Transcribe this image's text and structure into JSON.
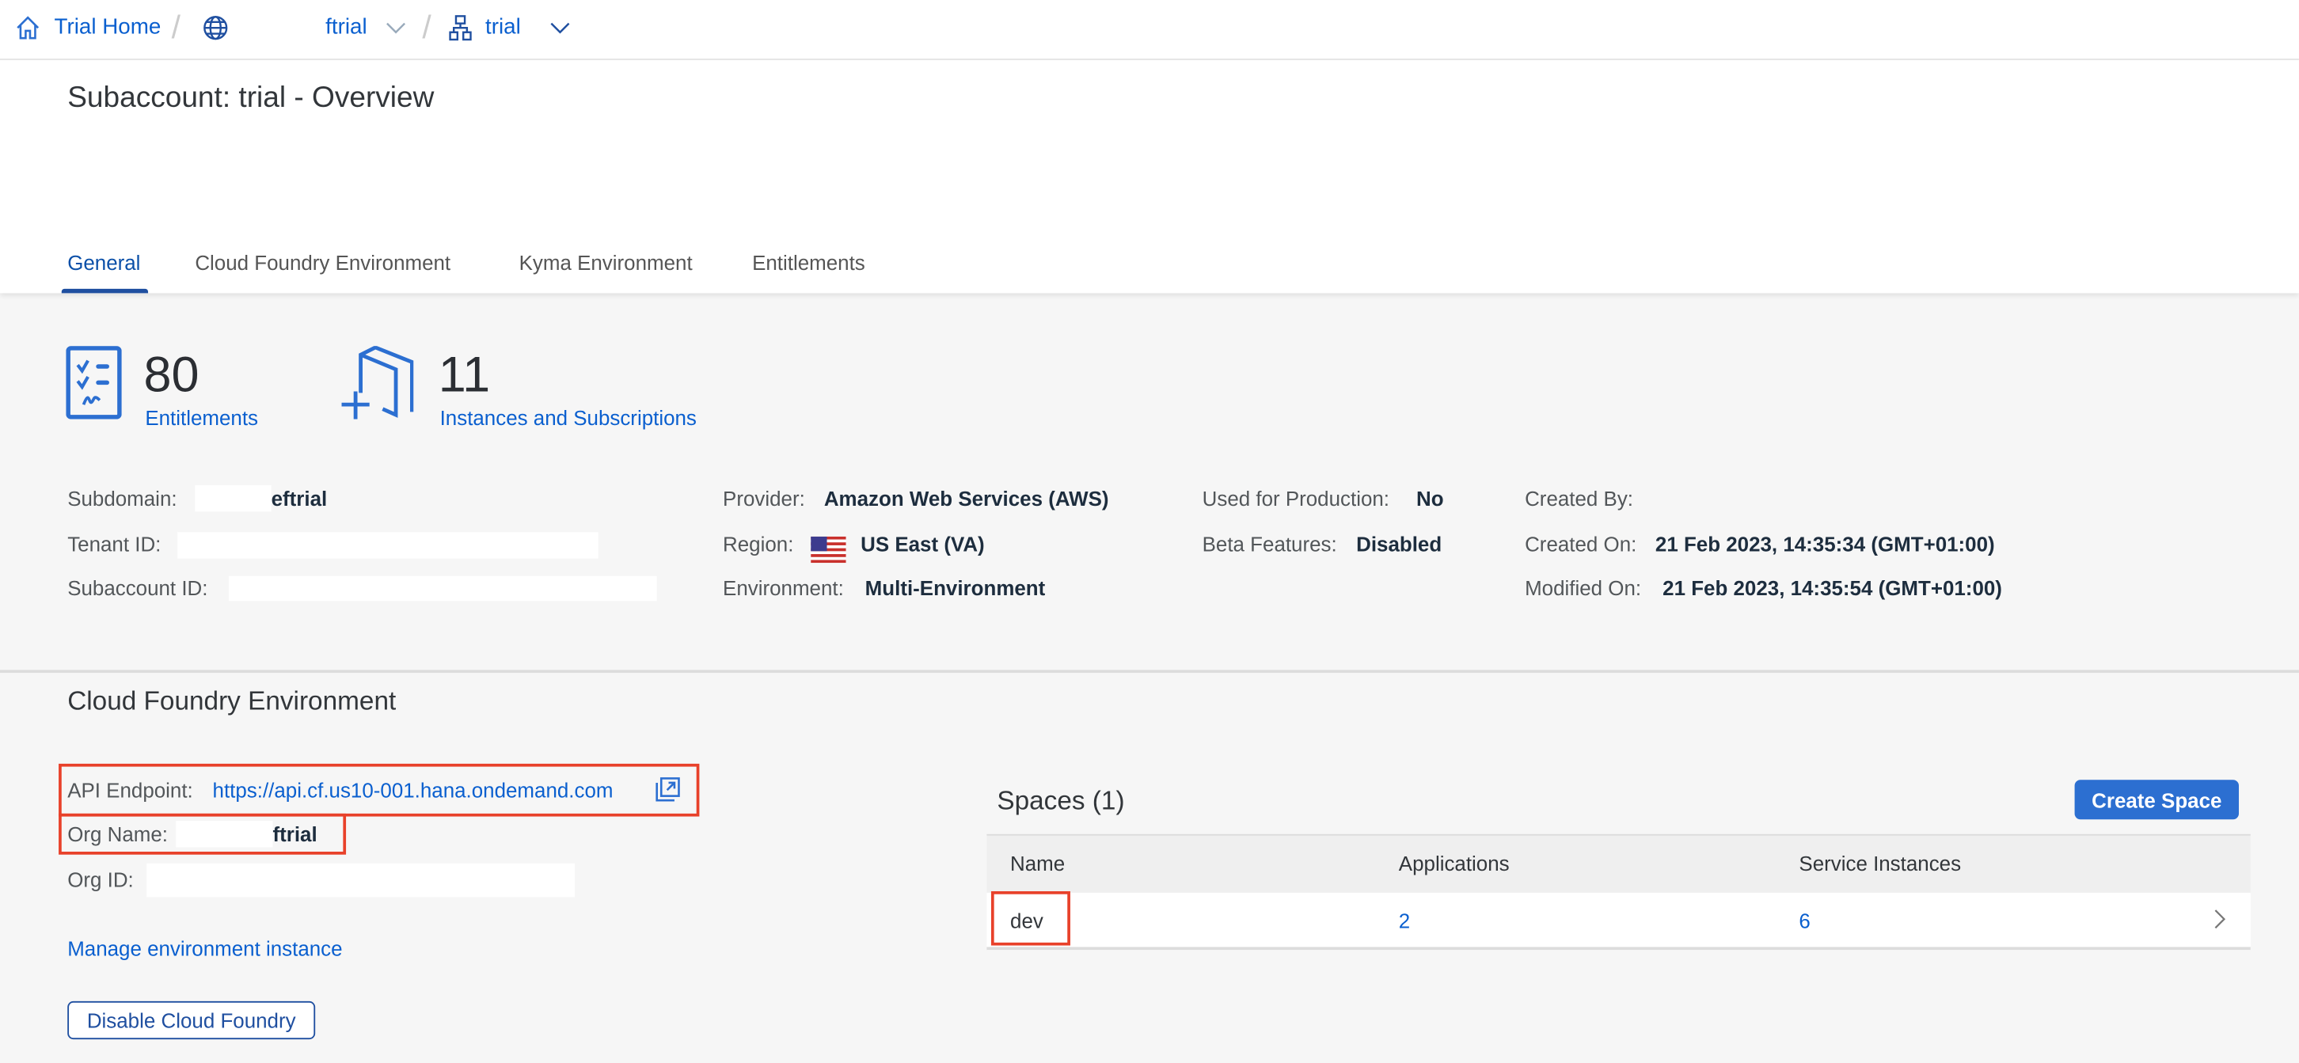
{
  "breadcrumb": {
    "home_label": "Trial Home",
    "global_account": "ftrial",
    "subaccount": "trial",
    "icons": [
      "home-icon",
      "globe-icon",
      "hierarchy-icon",
      "chevron-down-icon"
    ]
  },
  "page_title": "Subaccount: trial - Overview",
  "tabs": [
    {
      "label": "General",
      "active": true
    },
    {
      "label": "Cloud Foundry Environment"
    },
    {
      "label": "Kyma Environment"
    },
    {
      "label": "Entitlements"
    }
  ],
  "kpis": [
    {
      "value": "80",
      "label": "Entitlements",
      "icon": "checklist-icon"
    },
    {
      "value": "11",
      "label": "Instances and Subscriptions",
      "icon": "add-instance-icon"
    }
  ],
  "details": {
    "subdomain": {
      "label": "Subdomain:",
      "value": "eftrial"
    },
    "tenant_id": {
      "label": "Tenant ID:"
    },
    "subaccount_id": {
      "label": "Subaccount ID:"
    },
    "provider": {
      "label": "Provider:",
      "value": "Amazon Web Services (AWS)"
    },
    "region": {
      "label": "Region:",
      "value": "US East (VA)"
    },
    "environment": {
      "label": "Environment:",
      "value": "Multi-Environment"
    },
    "used_for_production": {
      "label": "Used for Production:",
      "value": "No"
    },
    "beta_features": {
      "label": "Beta Features:",
      "value": "Disabled"
    },
    "created_by": {
      "label": "Created By:"
    },
    "created_on": {
      "label": "Created On:",
      "value": "21 Feb 2023, 14:35:34 (GMT+01:00)"
    },
    "modified_on": {
      "label": "Modified On:",
      "value": "21 Feb 2023, 14:35:54 (GMT+01:00)"
    }
  },
  "cf": {
    "title": "Cloud Foundry Environment",
    "api_label": "API Endpoint:",
    "api_value": "https://api.cf.us10-001.hana.ondemand.com",
    "org_name_label": "Org Name:",
    "org_name_value": "ftrial",
    "org_id_label": "Org ID:",
    "manage_link": "Manage environment instance",
    "disable_button": "Disable Cloud Foundry"
  },
  "spaces": {
    "title": "Spaces (1)",
    "create_button": "Create Space",
    "columns": [
      "Name",
      "Applications",
      "Service Instances"
    ],
    "rows": [
      {
        "name": "dev",
        "applications": "2",
        "service_instances": "6"
      }
    ]
  },
  "colors": {
    "accent": "#0a5fcf",
    "highlight": "#e8412a",
    "button": "#2c6fd1"
  }
}
